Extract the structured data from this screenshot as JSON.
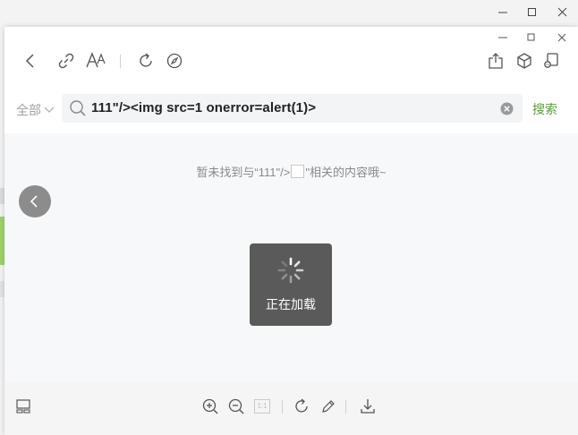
{
  "window": {
    "controls": [
      "minimize",
      "maximize",
      "close"
    ]
  },
  "toolbar": {
    "left_icons": [
      "back-icon",
      "link-icon",
      "font-size-icon",
      "refresh-icon",
      "compass-icon"
    ],
    "right_icons": [
      "share-icon",
      "cube-icon",
      "mini-program-icon"
    ]
  },
  "search": {
    "scope_label": "全部",
    "query": "111\"/><img src=1 onerror=alert(1)>",
    "submit_label": "搜索"
  },
  "results": {
    "empty_prefix": "暂未找到与“111\"/>",
    "empty_suffix": "\"相关的内容哦~"
  },
  "loading": {
    "label": "正在加载"
  },
  "bottom": {
    "tools": [
      "layout-icon",
      "zoom-in-icon",
      "zoom-out-icon",
      "actual-size-icon",
      "rotate-icon",
      "edit-icon",
      "download-icon"
    ],
    "actual_size_label": "1:1"
  },
  "colors": {
    "accent": "#5b9a3c",
    "loader_bg": "#5a5a5a"
  }
}
